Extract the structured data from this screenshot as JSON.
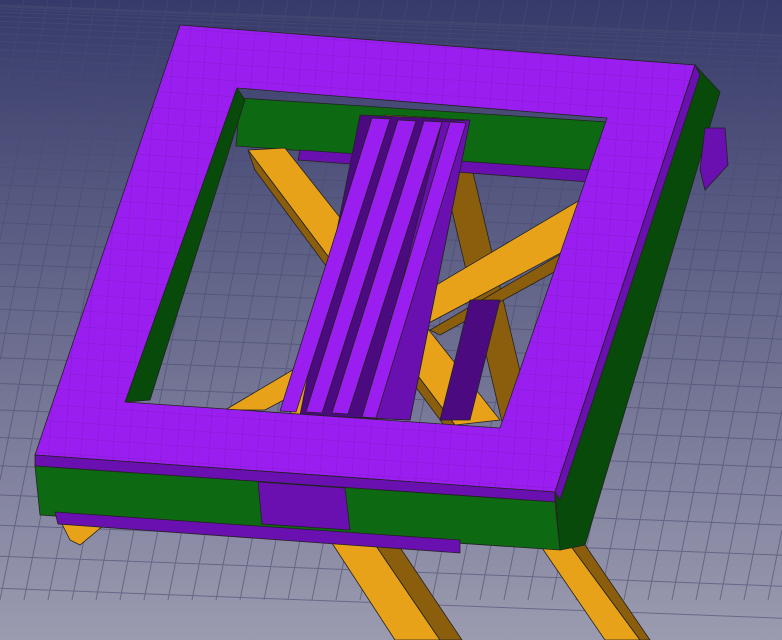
{
  "viewport": {
    "colors": {
      "bg_top": "#363a6a",
      "bg_bottom": "#9b9bb0",
      "grid": "#4a4c72",
      "purple_top": "#9b1ef0",
      "purple_side": "#6a0fb0",
      "purple_dark": "#4b0a80",
      "green": "#0d6a12",
      "green_dark": "#074a0a",
      "yellow": "#e8a21a",
      "yellow_dark": "#8a5e0c",
      "edge": "#222222"
    }
  }
}
